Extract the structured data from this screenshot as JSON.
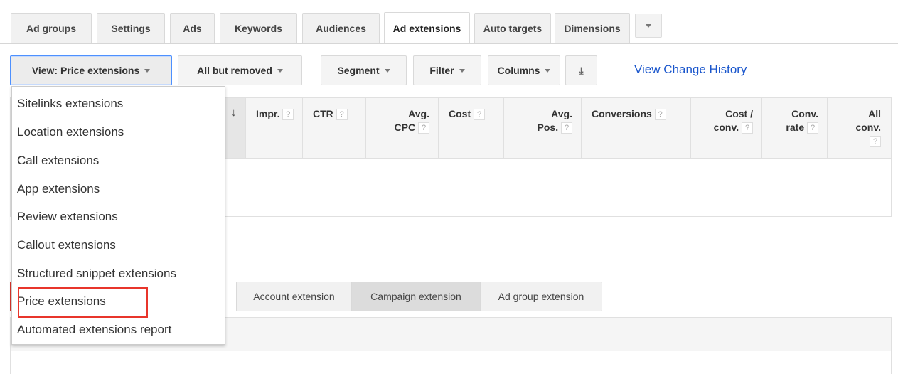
{
  "tabs": [
    {
      "label": "Ad groups",
      "active": false
    },
    {
      "label": "Settings",
      "active": false
    },
    {
      "label": "Ads",
      "active": false
    },
    {
      "label": "Keywords",
      "active": false
    },
    {
      "label": "Audiences",
      "active": false
    },
    {
      "label": "Ad extensions",
      "active": true
    },
    {
      "label": "Auto targets",
      "active": false
    },
    {
      "label": "Dimensions",
      "active": false
    }
  ],
  "tab_more_icon": "chevron-down-icon",
  "toolbar": {
    "view_label": "View: Price extensions",
    "status_filter_label": "All but removed",
    "segment_label": "Segment",
    "filter_label": "Filter",
    "columns_label": "Columns",
    "download_icon": "download-icon",
    "change_history_link": "View Change History"
  },
  "table": {
    "sort_indicator": "↓",
    "help_glyph": "?",
    "columns": [
      {
        "line1": "Impr.",
        "line2": ""
      },
      {
        "line1": "CTR",
        "line2": ""
      },
      {
        "line1": "Avg.",
        "line2": "CPC"
      },
      {
        "line1": "Cost",
        "line2": ""
      },
      {
        "line1": "Avg.",
        "line2": "Pos."
      },
      {
        "line1": "Conversions",
        "line2": ""
      },
      {
        "line1": "Cost /",
        "line2": "conv."
      },
      {
        "line1": "Conv.",
        "line2": "rate"
      },
      {
        "line1": "All",
        "line2": "conv."
      }
    ]
  },
  "extension_level": {
    "options": [
      "Account extension",
      "Campaign extension",
      "Ad group extension"
    ],
    "selected": "Campaign extension"
  },
  "view_menu": {
    "items": [
      "Sitelinks extensions",
      "Location extensions",
      "Call extensions",
      "App extensions",
      "Review extensions",
      "Callout extensions",
      "Structured snippet extensions",
      "Price extensions",
      "Automated extensions report"
    ],
    "highlighted": "Price extensions",
    "highlight_color": "#e8352b"
  },
  "colors": {
    "link": "#1a56cc",
    "focus_border": "#4d90fe"
  }
}
